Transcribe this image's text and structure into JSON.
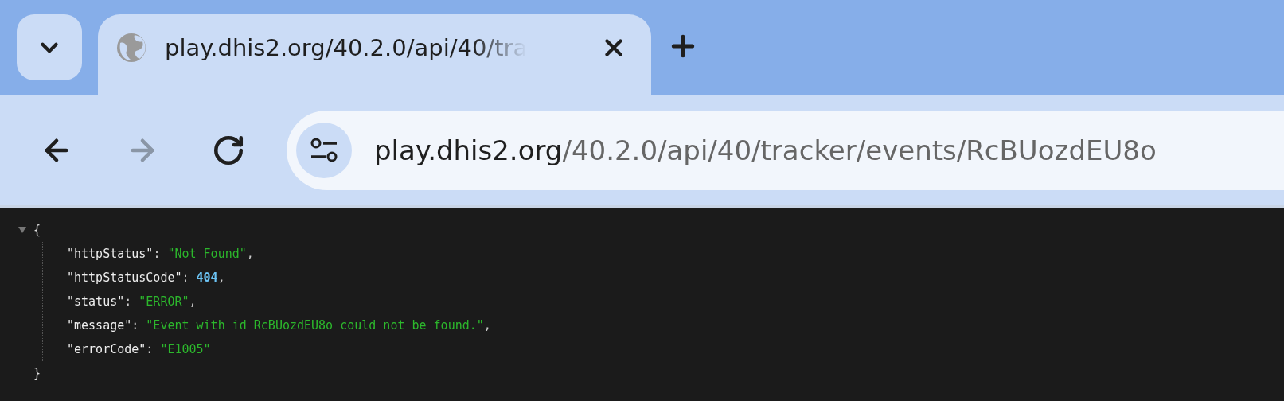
{
  "tab_strip": {
    "tabs": [
      {
        "title": "play.dhis2.org/40.2.0/api/40/tra",
        "selected": true
      }
    ]
  },
  "toolbar": {
    "nav_buttons": [
      {
        "kind": "back",
        "disabled": false
      },
      {
        "kind": "forward",
        "disabled": true
      },
      {
        "kind": "reload",
        "disabled": false
      }
    ],
    "address": {
      "host": "play.dhis2.org",
      "path": "/40.2.0/api/40/tracker/events/RcBUozdEU8o"
    }
  },
  "json_viewer": {
    "expanded": true,
    "open_brace": "{",
    "close_brace": "}",
    "entries": [
      {
        "key": "\"httpStatus\"",
        "colon": ":",
        "value": "\"Not Found\"",
        "comma": ",",
        "kind": "string"
      },
      {
        "key": "\"httpStatusCode\"",
        "colon": ":",
        "value": "404",
        "comma": ",",
        "kind": "number"
      },
      {
        "key": "\"status\"",
        "colon": ":",
        "value": "\"ERROR\"",
        "comma": ",",
        "kind": "string"
      },
      {
        "key": "\"message\"",
        "colon": ":",
        "value": "\"Event with id RcBUozdEU8o could not be found.\"",
        "comma": ",",
        "kind": "string"
      },
      {
        "key": "\"errorCode\"",
        "colon": ":",
        "value": "\"E1005\"",
        "kind": "string"
      }
    ]
  }
}
